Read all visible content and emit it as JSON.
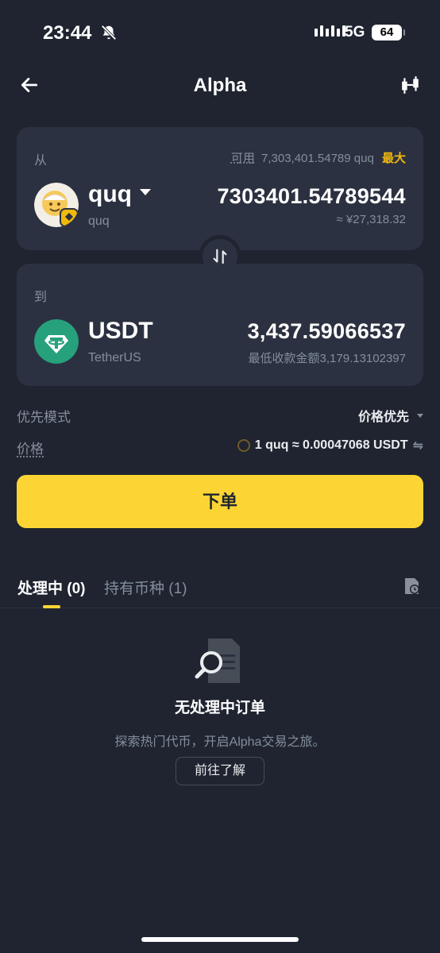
{
  "status_bar": {
    "time": "23:44",
    "network": "5G",
    "battery": "64"
  },
  "nav": {
    "title": "Alpha"
  },
  "from_card": {
    "label": "从",
    "available_label": "可用",
    "available_value": "7,303,401.54789 quq",
    "max_label": "最大",
    "token_name": "quq",
    "token_sub": "quq",
    "amount": "7303401.54789544",
    "fiat_value": "≈ ¥27,318.32"
  },
  "to_card": {
    "label": "到",
    "token_name": "USDT",
    "token_sub": "TetherUS",
    "amount": "3,437.59066537",
    "min_receive": "最低收款金额3,179.13102397"
  },
  "priority": {
    "label": "优先模式",
    "value": "价格优先"
  },
  "price": {
    "label": "价格",
    "value": "1 quq ≈ 0.00047068 USDT",
    "swap_glyph": "⇋"
  },
  "order_button": "下单",
  "tabs": [
    {
      "label": "处理中 (0)"
    },
    {
      "label": "持有币种 (1)"
    }
  ],
  "empty_state": {
    "title": "无处理中订单",
    "subtitle": "探索热门代币，开启Alpha交易之旅。",
    "button": "前往了解"
  },
  "colors": {
    "accent": "#fcd535",
    "background": "#1f2430",
    "card": "#2b3140",
    "muted": "#848e9c",
    "usdt": "#26a17b"
  }
}
